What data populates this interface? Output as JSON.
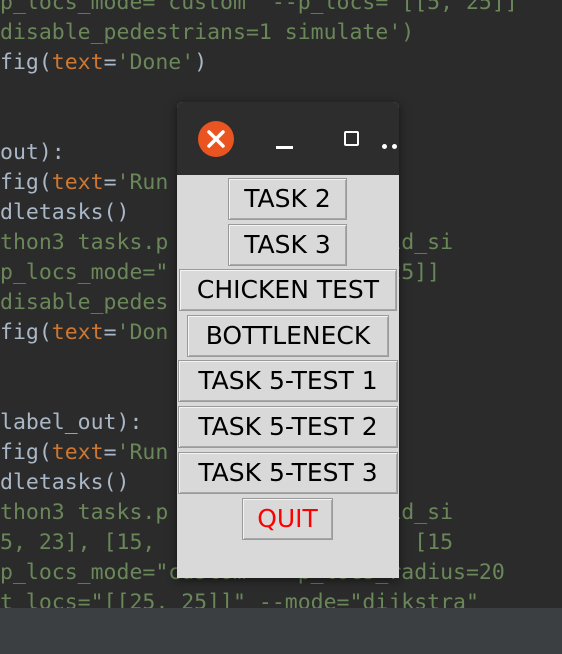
{
  "editor": {
    "lines": [
      {
        "segments": [
          {
            "text": "p_locs_mode=\"custom\" --p_locs=\"[[5, 25]]",
            "cls": "str"
          }
        ]
      },
      {
        "segments": [
          {
            "text": "disable_pedestrians=1 simulate')",
            "cls": "str"
          }
        ]
      },
      {
        "segments": [
          {
            "text": "fig(",
            "cls": ""
          },
          {
            "text": "text",
            "cls": "kw"
          },
          {
            "text": "=",
            "cls": ""
          },
          {
            "text": "'Done'",
            "cls": "str"
          },
          {
            "text": ")",
            "cls": ""
          }
        ]
      },
      {
        "segments": [
          {
            "text": "",
            "cls": ""
          }
        ]
      },
      {
        "segments": [
          {
            "text": "",
            "cls": ""
          }
        ]
      },
      {
        "segments": [
          {
            "text": "out):",
            "cls": ""
          }
        ]
      },
      {
        "segments": [
          {
            "text": "fig(",
            "cls": ""
          },
          {
            "text": "text",
            "cls": "kw"
          },
          {
            "text": "=",
            "cls": ""
          },
          {
            "text": "'Run",
            "cls": "str"
          }
        ]
      },
      {
        "segments": [
          {
            "text": "dletasks()",
            "cls": ""
          }
        ]
      },
      {
        "segments": [
          {
            "text": "thon3 tasks.p         =50 --grid_si",
            "cls": "str"
          }
        ]
      },
      {
        "segments": [
          {
            "text": "p_locs_mode=\"         s=\"[[5, 25]]",
            "cls": "str"
          }
        ]
      },
      {
        "segments": [
          {
            "text": "disable_pedes         te')",
            "cls": "str"
          }
        ]
      },
      {
        "segments": [
          {
            "text": "fig(",
            "cls": ""
          },
          {
            "text": "text",
            "cls": "kw"
          },
          {
            "text": "=",
            "cls": ""
          },
          {
            "text": "'Don",
            "cls": "str"
          }
        ]
      },
      {
        "segments": [
          {
            "text": "",
            "cls": ""
          }
        ]
      },
      {
        "segments": [
          {
            "text": "",
            "cls": ""
          }
        ]
      },
      {
        "segments": [
          {
            "text": "label_out):",
            "cls": ""
          }
        ]
      },
      {
        "segments": [
          {
            "text": "fig(",
            "cls": ""
          },
          {
            "text": "text",
            "cls": "kw"
          },
          {
            "text": "=",
            "cls": ""
          },
          {
            "text": "'Run         st...')",
            "cls": "str"
          }
        ]
      },
      {
        "segments": [
          {
            "text": "dletasks()",
            "cls": ""
          }
        ]
      },
      {
        "segments": [
          {
            "text": "thon3 tasks.p         =50 --grid_si",
            "cls": "str"
          }
        ]
      },
      {
        "segments": [
          {
            "text": "5, 23], [15,          [15, 26], [15",
            "cls": "str"
          }
        ]
      },
      {
        "segments": [
          {
            "text": "p_locs_mode=\"custom\" --p_locs_radius=20",
            "cls": "str"
          }
        ]
      },
      {
        "segments": [
          {
            "text": "t_locs=\"[[25, 25]]\" --mode=\"dijkstra\"",
            "cls": "str"
          }
        ]
      }
    ]
  },
  "window": {
    "buttons": [
      {
        "label": "TASK 2",
        "name": "task-2-button"
      },
      {
        "label": "TASK 3",
        "name": "task-3-button"
      },
      {
        "label": "CHICKEN TEST",
        "name": "chicken-test-button"
      },
      {
        "label": "BOTTLENECK",
        "name": "bottleneck-button"
      },
      {
        "label": "TASK 5-TEST 1",
        "name": "task-5-test-1-button"
      },
      {
        "label": "TASK 5-TEST 2",
        "name": "task-5-test-2-button"
      },
      {
        "label": "TASK 5-TEST 3",
        "name": "task-5-test-3-button"
      },
      {
        "label": "QUIT",
        "name": "quit-button"
      }
    ],
    "titlebar_icons": {
      "close": "close-icon",
      "minimize": "minimize-icon",
      "maximize": "maximize-icon",
      "more": "more-icon"
    }
  },
  "colors": {
    "editor_bg": "#2b2b2b",
    "string": "#6a8759",
    "keyword": "#cc7832",
    "default_text": "#a9b7c6",
    "close_button": "#e95420",
    "quit_text": "#ff0000",
    "dialog_bg": "#d9d9d9"
  }
}
